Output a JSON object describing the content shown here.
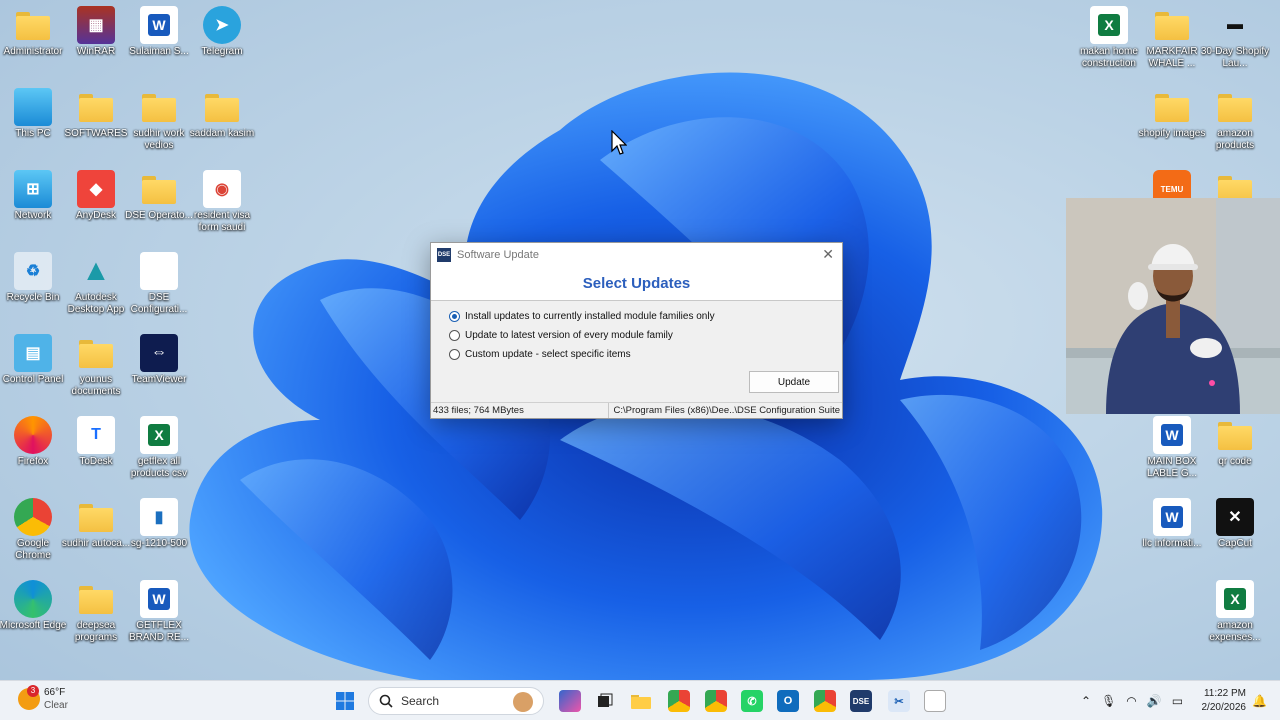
{
  "desktop": {
    "icons_left": [
      {
        "label": "Administrator",
        "icon": "user-folder-icon"
      },
      {
        "label": "WinRAR",
        "icon": "winrar-icon"
      },
      {
        "label": "Sulaiman S...",
        "icon": "word-doc-icon"
      },
      {
        "label": "Telegram",
        "icon": "telegram-icon"
      },
      {
        "label": "This PC",
        "icon": "monitor-icon"
      },
      {
        "label": "SOFTWARES",
        "icon": "folder-icon"
      },
      {
        "label": "sudhir work vedios",
        "icon": "folder-icon"
      },
      {
        "label": "saddam kasim",
        "icon": "folder-icon"
      },
      {
        "label": "Network",
        "icon": "network-icon"
      },
      {
        "label": "AnyDesk",
        "icon": "anydesk-icon"
      },
      {
        "label": "DSE Operato...",
        "icon": "folder-icon"
      },
      {
        "label": "resident visa form saudi",
        "icon": "chrome-doc-icon"
      },
      {
        "label": "Recycle Bin",
        "icon": "recycle-bin-icon"
      },
      {
        "label": "Autodesk Desktop App",
        "icon": "autodesk-icon"
      },
      {
        "label": "DSE Configurati...",
        "icon": "blank-file-icon"
      },
      {
        "label": "Control Panel",
        "icon": "control-panel-icon"
      },
      {
        "label": "younus documents",
        "icon": "folder-icon"
      },
      {
        "label": "TeamViewer",
        "icon": "teamviewer-icon"
      },
      {
        "label": "Firefox",
        "icon": "firefox-icon"
      },
      {
        "label": "ToDesk",
        "icon": "todesk-icon"
      },
      {
        "label": "getflex all products csv",
        "icon": "excel-csv-icon"
      },
      {
        "label": "Google Chrome",
        "icon": "chrome-icon"
      },
      {
        "label": "sudhir autoca...",
        "icon": "folder-icon"
      },
      {
        "label": "sg-1210-500",
        "icon": "file-icon"
      },
      {
        "label": "Microsoft Edge",
        "icon": "edge-icon"
      },
      {
        "label": "deepsea programs",
        "icon": "folder-icon"
      },
      {
        "label": "GETFLEX BRAND RE...",
        "icon": "word-doc-icon"
      }
    ],
    "icons_right": [
      {
        "label": "makan home construction",
        "icon": "excel-icon"
      },
      {
        "label": "MARKFAIR WHALE ...",
        "icon": "folder-icon"
      },
      {
        "label": "30-Day Shopify Lau...",
        "icon": "shortcut-icon"
      },
      {
        "label": "shopify images",
        "icon": "folder-icon"
      },
      {
        "label": "amazon products",
        "icon": "folder-icon"
      },
      {
        "label": "MAIN BOX LABLE G...",
        "icon": "word-doc-icon"
      },
      {
        "label": "qr code",
        "icon": "folder-icon"
      },
      {
        "label": "llc informati...",
        "icon": "word-doc-icon"
      },
      {
        "label": "CapCut",
        "icon": "capcut-icon"
      },
      {
        "label": "amazon expenses...",
        "icon": "excel-icon"
      }
    ],
    "temu_label": "TEMU"
  },
  "dialog": {
    "title": "Software Update",
    "app_icon_text": "DSE",
    "heading": "Select Updates",
    "options": [
      {
        "label": "Install updates to currently installed module families only",
        "checked": true
      },
      {
        "label": "Update to latest version of every module family",
        "checked": false
      },
      {
        "label": "Custom update - select specific items",
        "checked": false
      }
    ],
    "update_button": "Update",
    "status_files": "433 files; 764 MBytes",
    "status_path": "C:\\Program Files (x86)\\Dee..\\DSE Configuration Suite"
  },
  "taskbar": {
    "weather_temp": "66°F",
    "weather_desc": "Clear",
    "weather_badge": "3",
    "search_label": "Search",
    "dse_label": "DSE",
    "time": "11:22 PM",
    "date": "2/20/2026"
  },
  "colors": {
    "dialog_heading": "#2c5fbd",
    "wallpaper_blue": "#1a5fe0",
    "taskbar_bg": "#eef2f7"
  }
}
